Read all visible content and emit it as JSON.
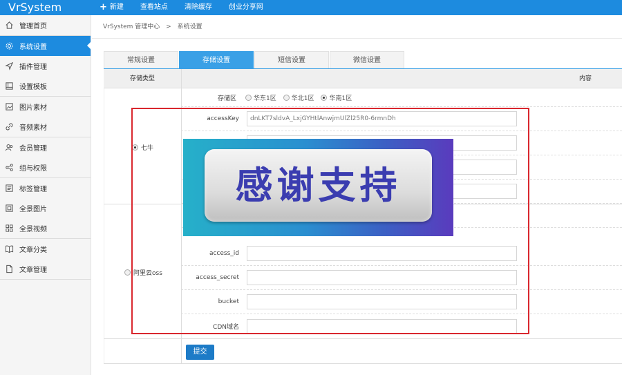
{
  "app": {
    "logo": "VrSystem"
  },
  "topnav": [
    {
      "label": "新建",
      "icon": "plus-icon"
    },
    {
      "label": "查看站点"
    },
    {
      "label": "清除缓存"
    },
    {
      "label": "创业分享网"
    }
  ],
  "sidebar": {
    "groups": [
      [
        {
          "label": "管理首页",
          "icon": "home-icon"
        }
      ],
      [
        {
          "label": "系统设置",
          "icon": "gear-icon",
          "active": true
        },
        {
          "label": "插件管理",
          "icon": "send-icon"
        },
        {
          "label": "设置模板",
          "icon": "template-icon"
        }
      ],
      [
        {
          "label": "图片素材",
          "icon": "image-icon"
        },
        {
          "label": "音频素材",
          "icon": "link-icon"
        }
      ],
      [
        {
          "label": "会员管理",
          "icon": "users-icon"
        },
        {
          "label": "组与权限",
          "icon": "share-icon"
        }
      ],
      [
        {
          "label": "标签管理",
          "icon": "tag-list-icon"
        },
        {
          "label": "全景图片",
          "icon": "panorama-image-icon"
        },
        {
          "label": "全景视频",
          "icon": "grid-icon"
        }
      ],
      [
        {
          "label": "文章分类",
          "icon": "book-icon"
        },
        {
          "label": "文章管理",
          "icon": "file-icon"
        }
      ]
    ]
  },
  "breadcrumb": {
    "root": "VrSystem 管理中心",
    "sep": ">",
    "current": "系统设置"
  },
  "tabs": [
    {
      "label": "常规设置"
    },
    {
      "label": "存储设置",
      "active": true
    },
    {
      "label": "短信设置"
    },
    {
      "label": "微信设置"
    }
  ],
  "table": {
    "col_type": "存储类型",
    "col_content": "内容"
  },
  "region": {
    "label": "存储区",
    "options": [
      {
        "label": "华东1区",
        "checked": false
      },
      {
        "label": "华北1区",
        "checked": false
      },
      {
        "label": "华南1区",
        "checked": true
      }
    ]
  },
  "providers": {
    "qiniu": {
      "label": "七牛",
      "checked": true
    },
    "aliyun": {
      "label": "阿里云oss",
      "checked": false
    }
  },
  "qiniu_fields": [
    {
      "label": "accessKey",
      "value": "dnLKT7sldvA_LxjGYHtlAnwjmUlZl25R0-6rmnDh"
    },
    {
      "label": "",
      "value": ""
    },
    {
      "label": "",
      "value": ""
    },
    {
      "label": "",
      "value": ""
    }
  ],
  "aliyun_fields": [
    {
      "label": "access_id",
      "value": ""
    },
    {
      "label": "access_secret",
      "value": ""
    },
    {
      "label": "bucket",
      "value": ""
    },
    {
      "label": "CDN域名",
      "value": ""
    }
  ],
  "submit": {
    "label": "提交"
  },
  "banner": {
    "text": "感谢支持"
  }
}
